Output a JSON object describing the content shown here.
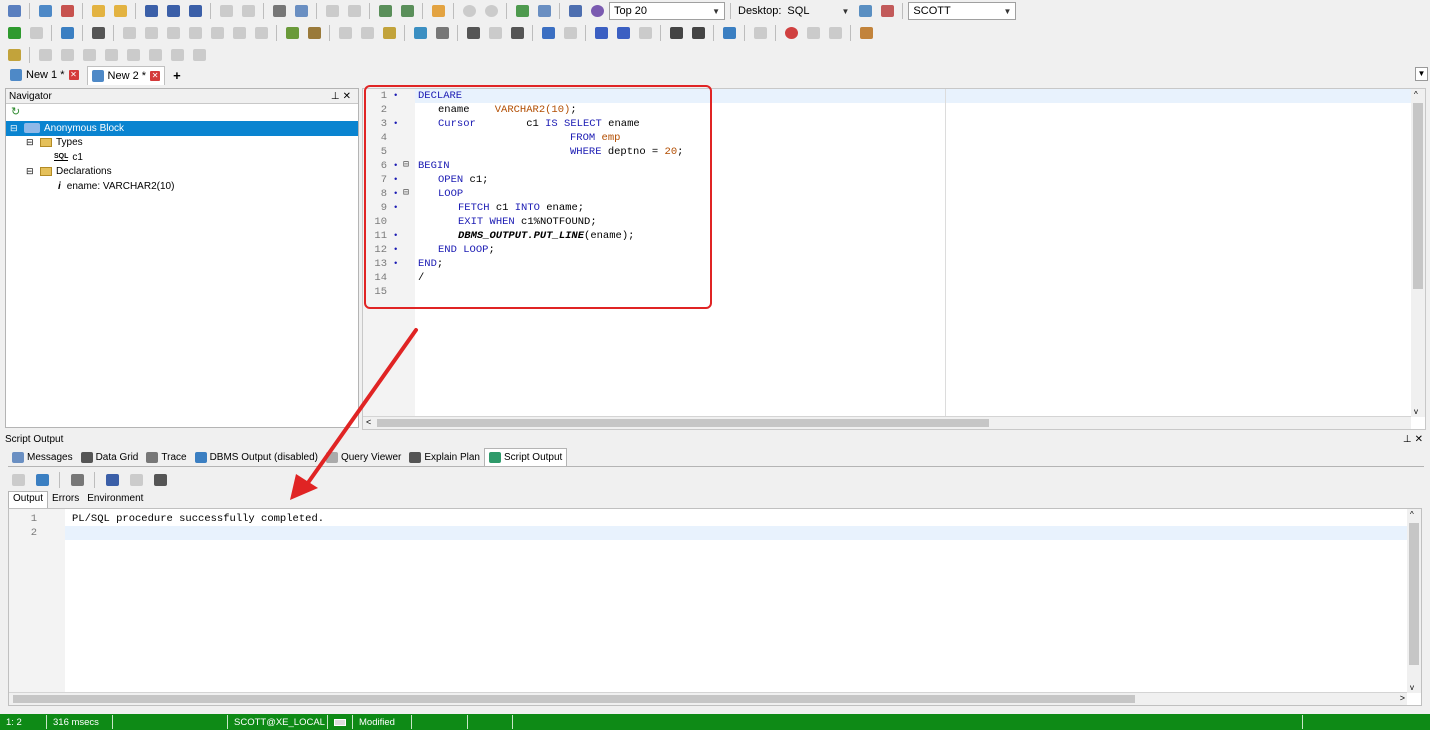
{
  "toolbar": {
    "top_rows_select": "Top 20",
    "desktop_label": "Desktop:",
    "desktop_select": "SQL",
    "connection_select": "SCOTT"
  },
  "editor_tabs": [
    {
      "label": "New 1 *"
    },
    {
      "label": "New 2 *"
    }
  ],
  "new_tab_symbol": "+",
  "navigator": {
    "title": "Navigator",
    "tree": [
      {
        "label": "Anonymous Block"
      },
      {
        "label": "Types"
      },
      {
        "label": "c1"
      },
      {
        "label": "Declarations"
      },
      {
        "label": "ename: VARCHAR2(10)"
      }
    ]
  },
  "editor": {
    "lines": [
      {
        "num": "1",
        "text": "DECLARE"
      },
      {
        "num": "2",
        "text": "ename    VARCHAR2(10);"
      },
      {
        "num": "3",
        "text": "Cursor        c1 IS SELECT ename"
      },
      {
        "num": "4",
        "text": "FROM emp"
      },
      {
        "num": "5",
        "text": "WHERE deptno = 20;"
      },
      {
        "num": "6",
        "text": "BEGIN"
      },
      {
        "num": "7",
        "text": "OPEN c1;"
      },
      {
        "num": "8",
        "text": "LOOP"
      },
      {
        "num": "9",
        "text": "FETCH c1 INTO ename;"
      },
      {
        "num": "10",
        "text": "EXIT WHEN c1%NOTFOUND;"
      },
      {
        "num": "11",
        "text": "DBMS_OUTPUT.PUT_LINE(ename);"
      },
      {
        "num": "12",
        "text": "END LOOP;"
      },
      {
        "num": "13",
        "text": "END;"
      },
      {
        "num": "14",
        "text": "/"
      },
      {
        "num": "15",
        "text": ""
      }
    ]
  },
  "script_output": {
    "title": "Script Output",
    "tabs": [
      {
        "label": "Messages"
      },
      {
        "label": "Data Grid"
      },
      {
        "label": "Trace"
      },
      {
        "label": "DBMS Output (disabled)"
      },
      {
        "label": "Query Viewer"
      },
      {
        "label": "Explain Plan"
      },
      {
        "label": "Script Output"
      }
    ],
    "sub_tabs": [
      {
        "label": "Output"
      },
      {
        "label": "Errors"
      },
      {
        "label": "Environment"
      }
    ],
    "lines": [
      {
        "num": "1",
        "text": "PL/SQL procedure successfully completed."
      },
      {
        "num": "2",
        "text": ""
      }
    ]
  },
  "status_bar": {
    "cursor_pos": "1:  2",
    "exec_time": "316 msecs",
    "connection": "SCOTT@XE_LOCAL",
    "state": "Modified"
  },
  "colors": {
    "accent": "#0a84d0",
    "status_green": "#0e8a16",
    "annotation_red": "#e02424",
    "keyword_blue": "#1a1ab3"
  }
}
